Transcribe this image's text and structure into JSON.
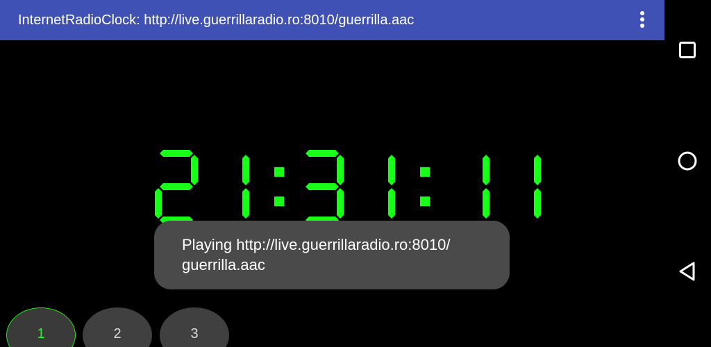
{
  "app_bar": {
    "title": "InternetRadioClock: http://live.guerrillaradio.ro:8010/guerrilla.aac",
    "overflow_icon": "more-vert-icon",
    "background": "#3F51B5"
  },
  "clock": {
    "time": "21:31:11",
    "color": "#19ff19"
  },
  "toast": {
    "line1": "Playing http://live.guerrillaradio.ro:8010/",
    "line2": "guerrilla.aac"
  },
  "presets": [
    {
      "label": "1",
      "active": true
    },
    {
      "label": "2",
      "active": false
    },
    {
      "label": "3",
      "active": false
    }
  ],
  "nav": {
    "recents_icon": "recents-square-icon",
    "home_icon": "home-circle-icon",
    "back_icon": "back-triangle-icon"
  }
}
